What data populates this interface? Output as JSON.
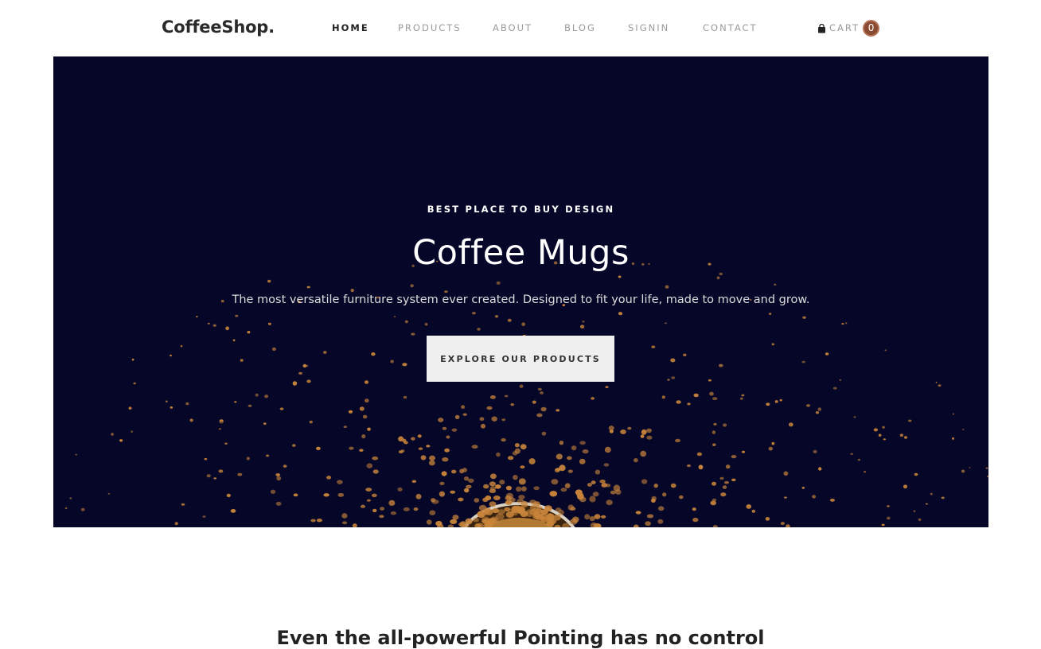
{
  "brand": {
    "logo": "CoffeeShop."
  },
  "nav": {
    "items": [
      {
        "label": "HOME",
        "active": true
      },
      {
        "label": "PRODUCTS",
        "active": false
      },
      {
        "label": "ABOUT",
        "active": false
      },
      {
        "label": "BLOG",
        "active": false
      },
      {
        "label": "SIGNIN",
        "active": false
      },
      {
        "label": "CONTACT",
        "active": false
      }
    ],
    "cart": {
      "icon": "shopping-bag-icon",
      "label": "CART",
      "count": "0",
      "badge_color": "#8a4b32"
    }
  },
  "hero": {
    "eyebrow": "BEST PLACE TO BUY DESIGN",
    "title": "Coffee Mugs",
    "description": "The most versatile furniture system ever created. Designed to fit your life, made to move and grow.",
    "cta_label": "EXPLORE OUR PRODUCTS",
    "background_color": "#050628",
    "particle_color": "#c8843a"
  },
  "section": {
    "title": "Even the all-powerful Pointing has no control"
  }
}
